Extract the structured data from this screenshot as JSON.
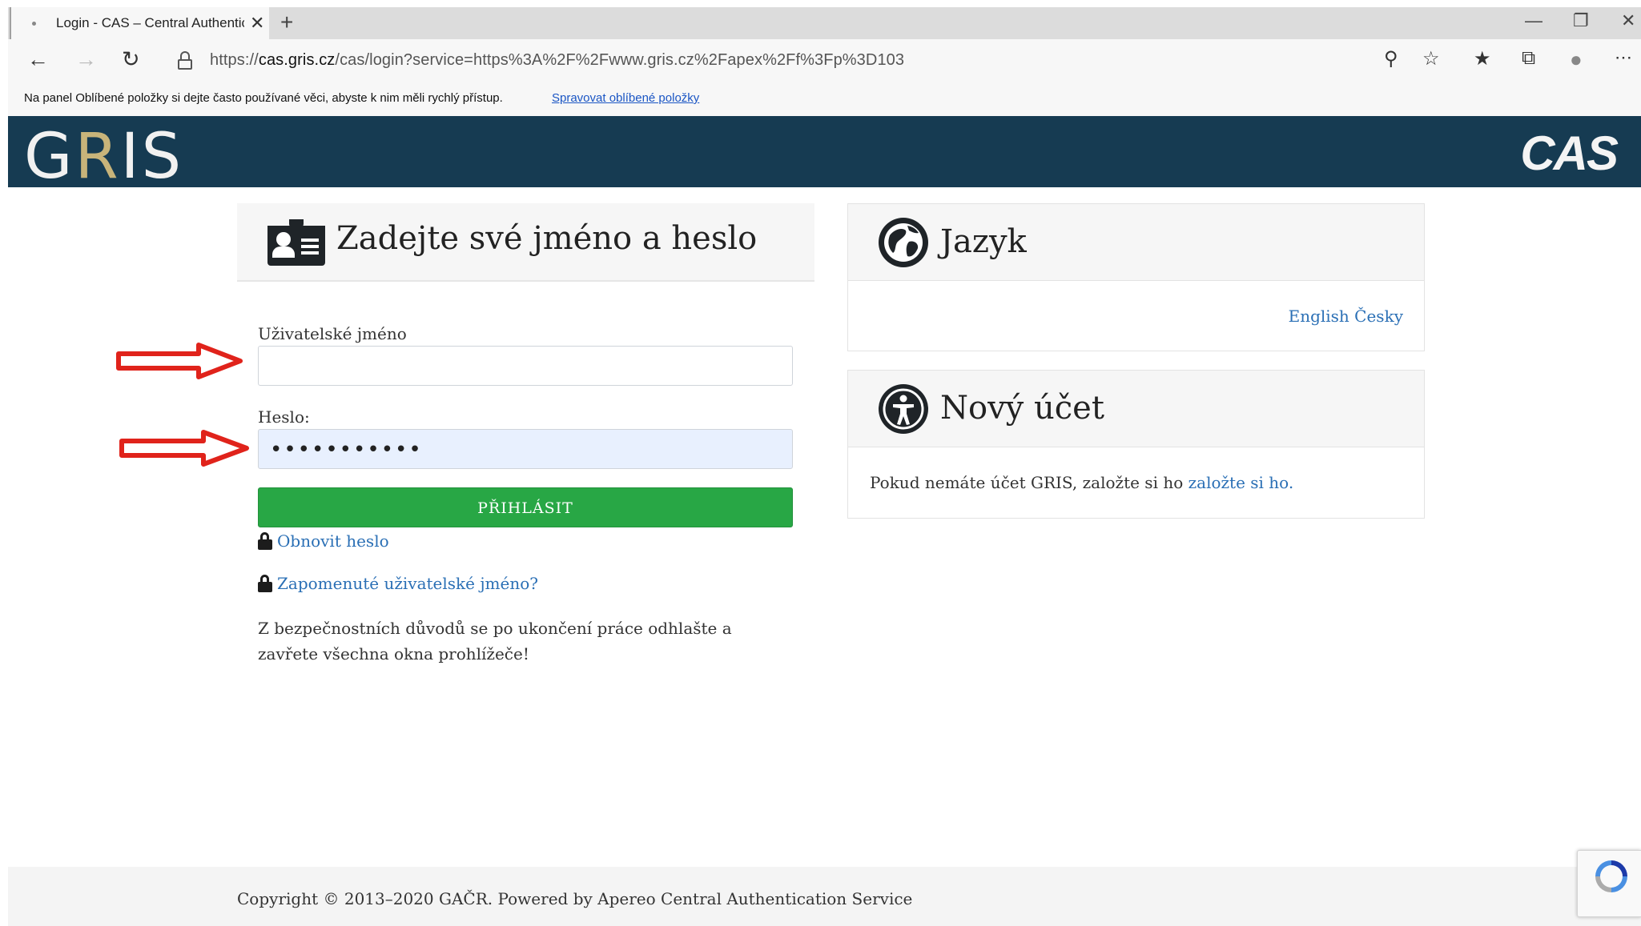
{
  "browser": {
    "tab_title": "Login - CAS – Central Authentication Service",
    "tab_close": "✕",
    "new_tab": "+",
    "url_prefix": "https://",
    "url_host": "cas.gris.cz",
    "url_path": "/cas/login?service=https%3A%2F%2Fwww.gris.cz%2Fapex%2Ff%3Fp%3D103",
    "favbar_message": "Na panel Oblíbené položky si dejte často používané věci, abyste k nim měli rychlý přístup.",
    "favbar_link": "Spravovat oblíbené položky"
  },
  "header": {
    "logo_left_a": "G",
    "logo_left_r": "R",
    "logo_left_b": "IS",
    "logo_right": "CAS"
  },
  "login": {
    "title": "Zadejte své jméno a heslo",
    "username_label": "Uživatelské jméno",
    "username_value": "",
    "password_label": "Heslo:",
    "password_value": "•••••••••••",
    "submit_label": "PŘIHLÁSIT",
    "reset_password_link": "Obnovit heslo",
    "forgot_username_link": "Zapomenuté uživatelské jméno?",
    "security_note": "Z bezpečnostních důvodů se po ukončení práce odhlašte a zavřete všechna okna prohlížeče!"
  },
  "language": {
    "title": "Jazyk",
    "options": "English Česky"
  },
  "account": {
    "title": "Nový účet",
    "text": "Pokud nemáte účet GRIS, založte si ho ",
    "link": "založte si ho."
  },
  "footer": {
    "text": "Copyright © 2013–2020 GAČR. Powered by Apereo Central Authentication Service"
  },
  "colors": {
    "header_bg": "#163b52",
    "button_green": "#28a745",
    "link_blue": "#2a6fb5",
    "arrow_red": "#e0231b"
  }
}
